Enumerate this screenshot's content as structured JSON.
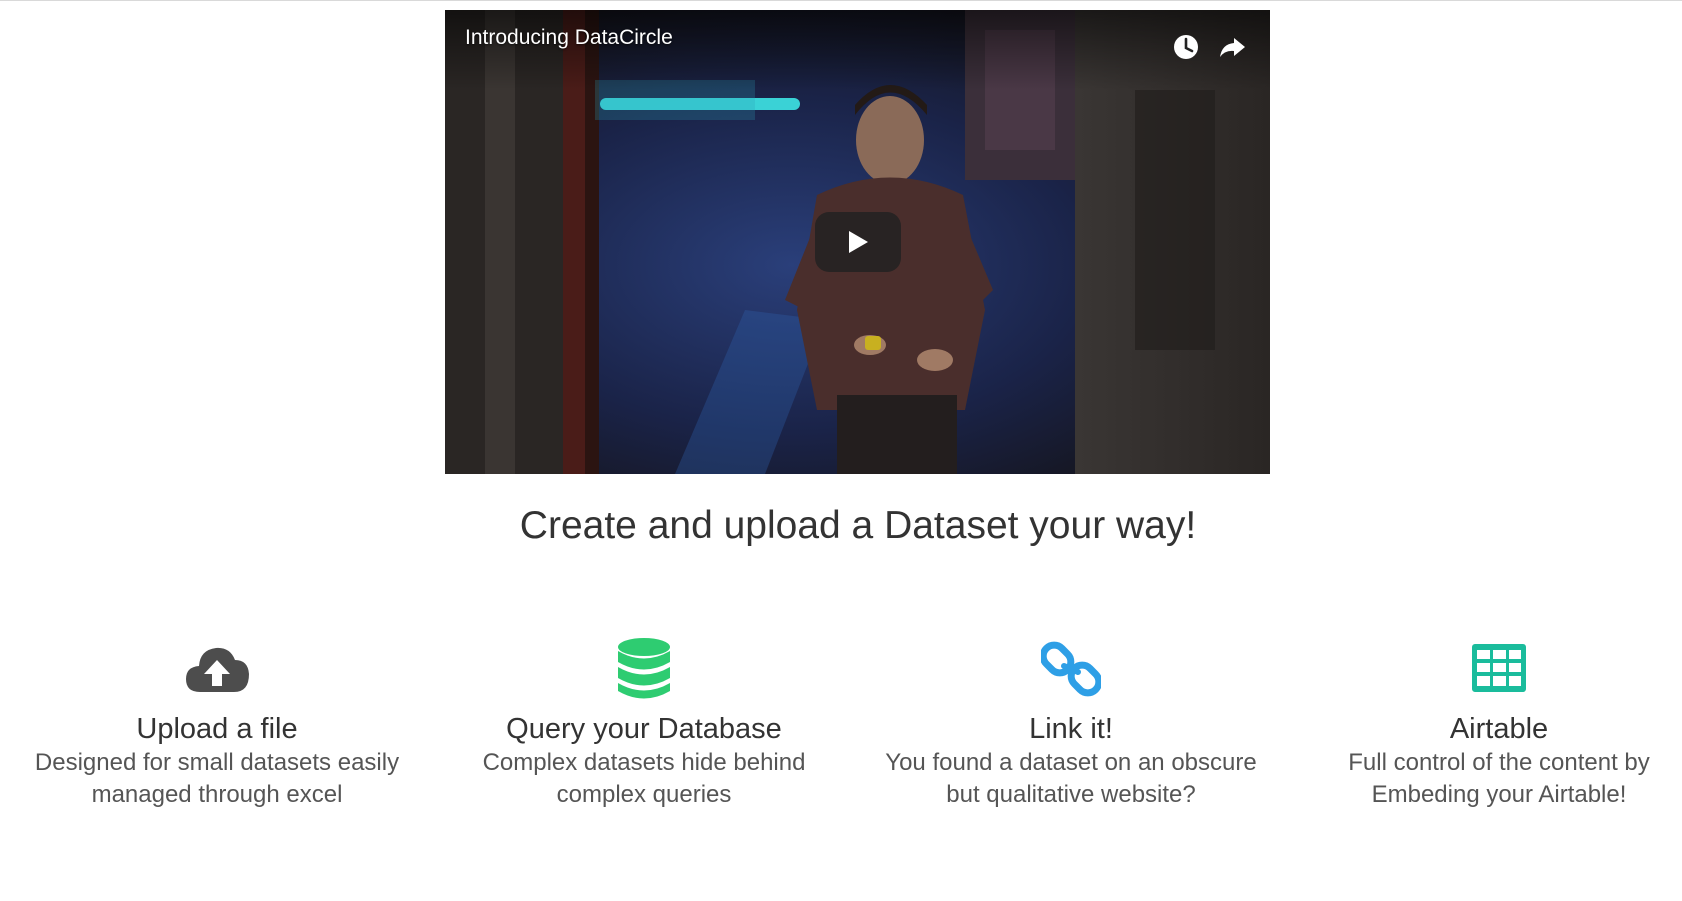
{
  "video": {
    "title": "Introducing DataCircle",
    "controls": {
      "watch_later_icon": "clock-icon",
      "share_icon": "share-arrow-icon",
      "play_icon": "play-icon"
    }
  },
  "heading": "Create and upload a Dataset your way!",
  "features": [
    {
      "icon": "cloud-upload-icon",
      "icon_color": "#4d4d4d",
      "title": "Upload a file",
      "desc_line1": "Designed for small datasets easily",
      "desc_line2": "managed through excel"
    },
    {
      "icon": "database-icon",
      "icon_color": "#2ecc71",
      "title": "Query your Database",
      "desc_line1": "Complex datasets hide behind",
      "desc_line2": "complex queries"
    },
    {
      "icon": "link-icon",
      "icon_color": "#2e9fe6",
      "title": "Link it!",
      "desc_line1": "You found a dataset on an obscure",
      "desc_line2": "but qualitative website?"
    },
    {
      "icon": "table-grid-icon",
      "icon_color": "#1abc9c",
      "title": "Airtable",
      "desc_line1": "Full control of the content by",
      "desc_line2": "Embeding your Airtable!"
    }
  ]
}
